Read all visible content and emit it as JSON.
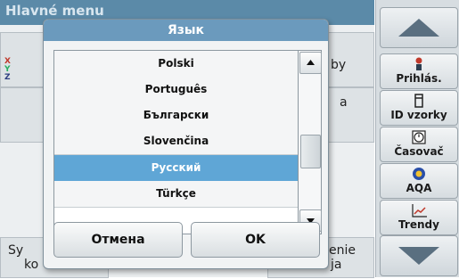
{
  "background": {
    "title": "Hlavné menu",
    "tiles": {
      "top_right_fragment": "by",
      "mid_right_fragment": "a",
      "bottom_left_fragment1": "Sy",
      "bottom_left_fragment2": "ko",
      "bottom_right_fragment1": "enie",
      "bottom_right_fragment2": "ja",
      "xyz": [
        "X",
        "Y",
        "Z"
      ]
    }
  },
  "sidebar": {
    "buttons": [
      {
        "label": "Prihlás.",
        "icon": "person-icon"
      },
      {
        "label": "ID vzorky",
        "icon": "vial-icon"
      },
      {
        "label": "Časovač",
        "icon": "timer-icon"
      },
      {
        "label": "AQA",
        "icon": "aqa-icon"
      },
      {
        "label": "Trendy",
        "icon": "trend-chart-icon"
      }
    ]
  },
  "dialog": {
    "title": "Язык",
    "items": [
      "Polski",
      "Português",
      "Български",
      "Slovenčina",
      "Русский",
      "Türkçe"
    ],
    "selected_index": 4,
    "cancel_label": "Отмена",
    "ok_label": "OK"
  },
  "colors": {
    "header": "#5b8aa8",
    "dialog_title": "#6b9abd",
    "selection": "#5fa6d6"
  }
}
